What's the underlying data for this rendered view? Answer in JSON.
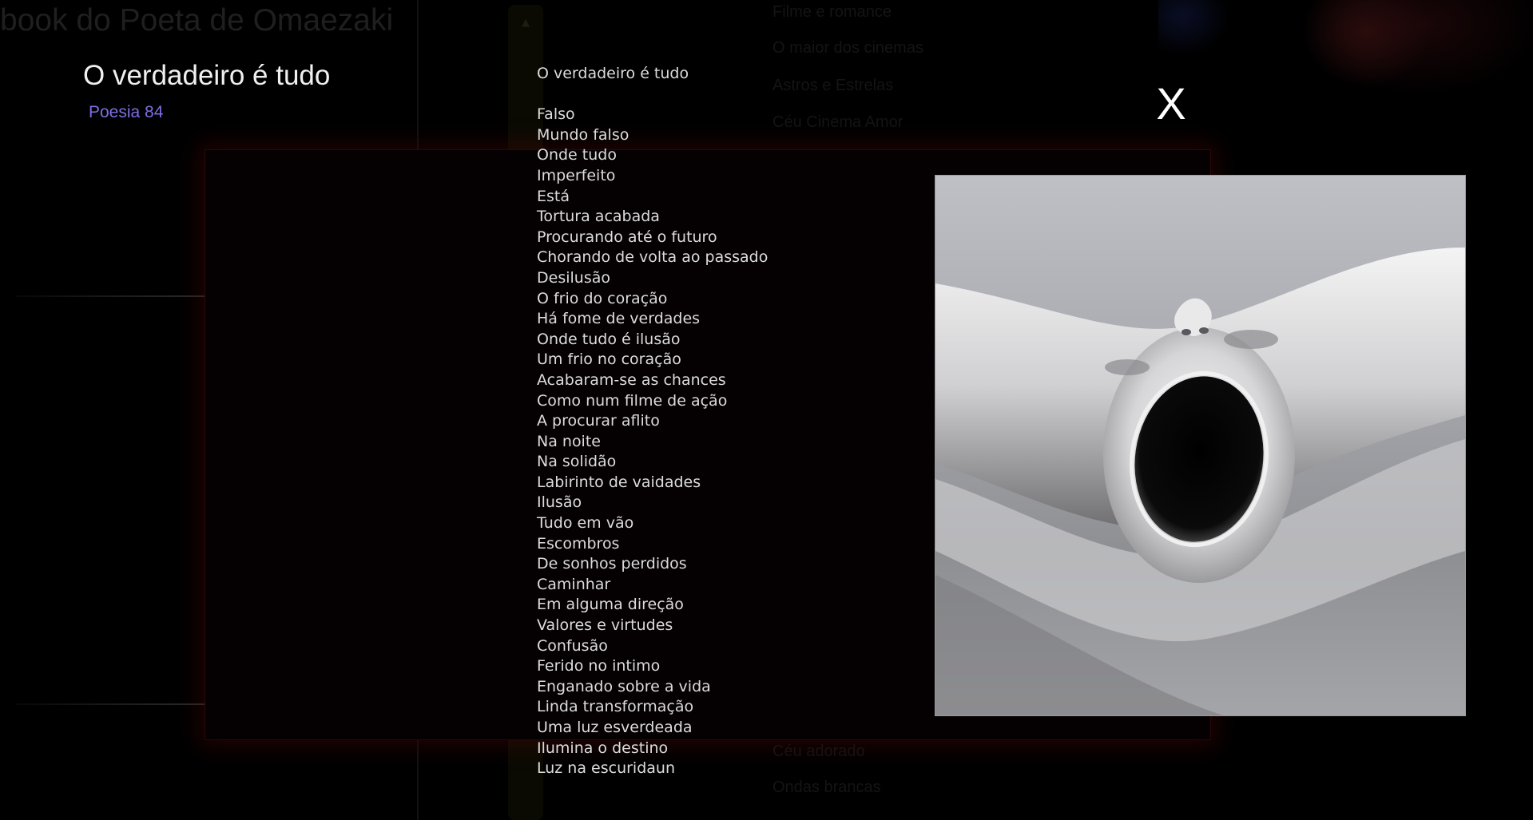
{
  "site": {
    "title": "book do Poeta de Omaezaki"
  },
  "poem": {
    "heading": "O verdadeiro é tudo",
    "subtitle": "Poesia 84",
    "body_title": "O verdadeiro é tudo",
    "lines": [
      "Falso",
      "Mundo falso",
      "Onde tudo",
      "Imperfeito",
      "Está",
      "Tortura acabada",
      "Procurando até o futuro",
      "Chorando de volta ao passado",
      "Desilusão",
      "O frio do coração",
      "Há fome de verdades",
      "Onde tudo é ilusão",
      "Um frio no coração",
      "Acabaram-se as chances",
      "Como num filme de ação",
      "A procurar aflito",
      "Na noite",
      "Na solidão",
      "Labirinto de vaidades",
      "Ilusão",
      "Tudo em vão",
      "Escombros",
      "De sonhos perdidos",
      "Caminhar",
      "Em alguma direção",
      "Valores e virtudes",
      "Confusão",
      "Ferido no intimo",
      "Enganado sobre a vida",
      "Linda transformação",
      "Uma luz esverdeada",
      "Ilumina o destino",
      "Luz na escuridaun"
    ]
  },
  "modal": {
    "close_label": "X"
  },
  "menu": {
    "top_items": [
      "Filme e romance",
      "O maior dos cinemas",
      "Astros e Estrelas",
      "Céu Cinema Amor"
    ],
    "bottom_items": [
      "Céu adorado",
      "Ondas brancas"
    ]
  },
  "icons": {
    "scroll_up": "chevron-up-icon",
    "illustration": "screaming-face-illustration"
  },
  "colors": {
    "subtitle": "#7b6fe3",
    "background": "#000000",
    "poem_text": "#dcdcdc"
  }
}
